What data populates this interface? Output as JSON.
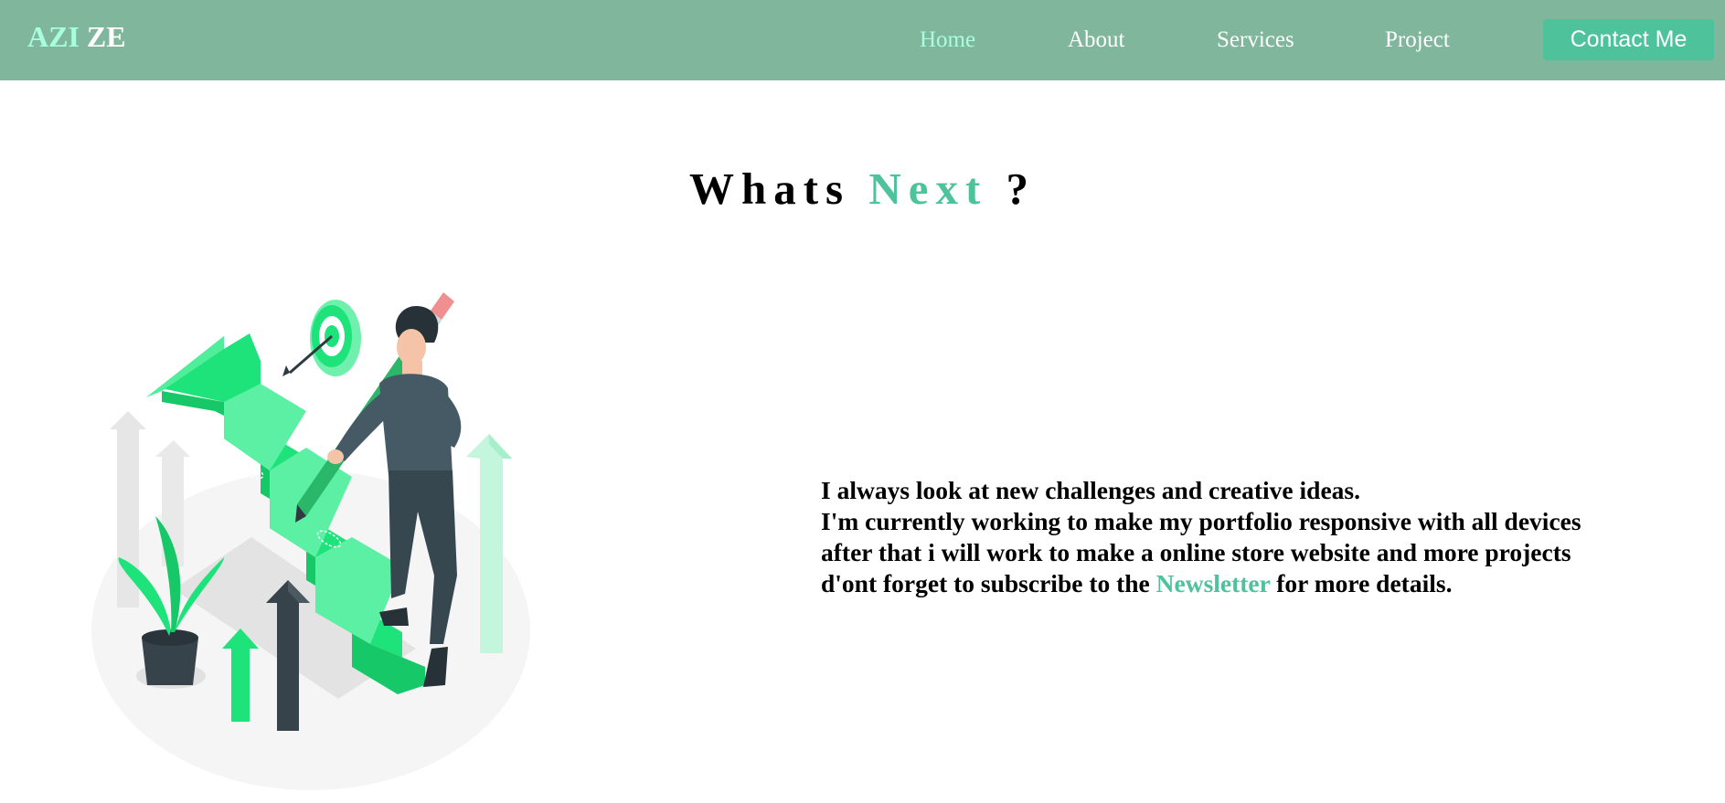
{
  "colors": {
    "navbar_bg": "#80b69c",
    "accent": "#4ec39b",
    "logo_accent": "#a8ffe0",
    "active_link": "#a8ffe0"
  },
  "header": {
    "logo_part1": "AZI",
    "logo_part2": "ZE",
    "nav": [
      {
        "label": "Home",
        "active": true
      },
      {
        "label": "About",
        "active": false
      },
      {
        "label": "Services",
        "active": false
      },
      {
        "label": "Project",
        "active": false
      }
    ],
    "contact_label": "Contact Me"
  },
  "main": {
    "heading_part1": "Whats",
    "heading_accent": "Next",
    "heading_part2": "?",
    "paragraph": {
      "line1": "I always look at new challenges and creative ideas.",
      "line2": "I'm currently working to make my portfolio responsive with all devices",
      "line3": "after that i will work to make a online store website and more projects",
      "line4_before": "d'ont forget to subscribe to the",
      "line4_link": "Newsletter",
      "line4_after": "for more details."
    }
  },
  "illustration": {
    "icon": "growth-stairs-illustration"
  }
}
